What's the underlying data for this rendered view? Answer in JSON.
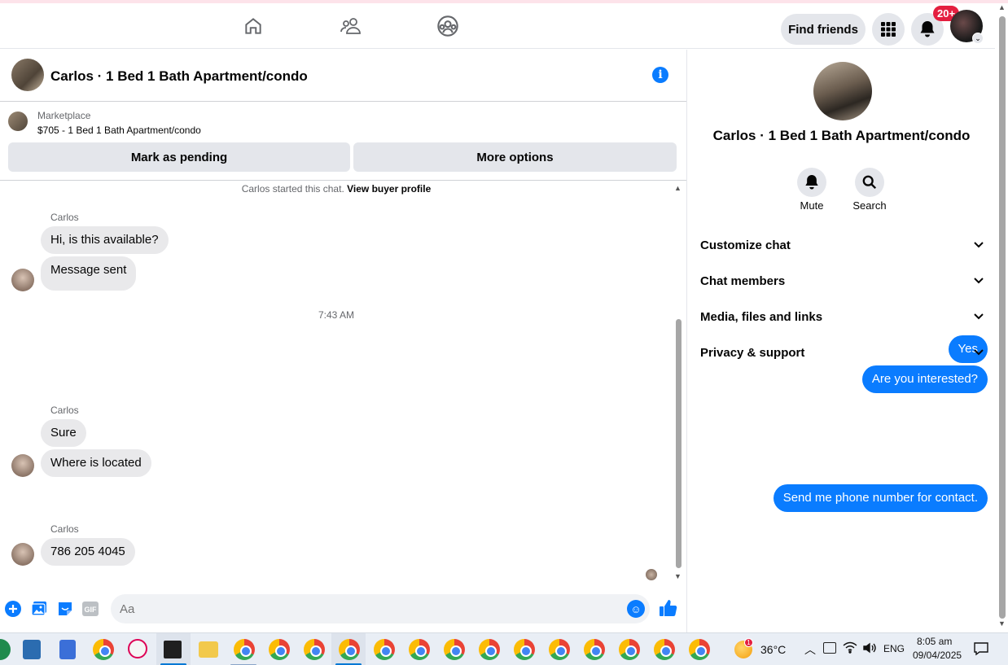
{
  "nav": {
    "find_friends": "Find friends",
    "notifications_badge": "20+"
  },
  "chat": {
    "title": "Carlos · 1 Bed 1 Bath Apartment/condo",
    "marketplace_label": "Marketplace",
    "listing": "$705 - 1 Bed 1 Bath Apartment/condo",
    "mark_pending": "Mark as pending",
    "more_options": "More options",
    "started_text": "Carlos started this chat.",
    "view_buyer_profile": "View buyer profile",
    "messages": [
      {
        "sender": "Carlos",
        "text": "Hi, is this available?"
      },
      {
        "text": "Message sent"
      },
      {
        "timestamp": "7:43 AM"
      },
      {
        "outgoing": true,
        "text": "Yes"
      },
      {
        "outgoing": true,
        "text": "Are you interested?"
      },
      {
        "sender": "Carlos",
        "text": "Sure"
      },
      {
        "text": "Where is located"
      },
      {
        "outgoing": true,
        "text": "Send me phone number for contact."
      },
      {
        "sender": "Carlos",
        "text": "786 205 4045"
      }
    ],
    "input_placeholder": "Aa"
  },
  "panel": {
    "title": "Carlos · 1 Bed 1 Bath Apartment/condo",
    "mute": "Mute",
    "search": "Search",
    "sections": [
      "Customize chat",
      "Chat members",
      "Media, files and links",
      "Privacy & support"
    ]
  },
  "taskbar": {
    "weather": "36°C",
    "weather_badge": "1",
    "lang": "ENG",
    "time": "8:05 am",
    "date": "09/04/2025"
  },
  "colors": {
    "accent": "#0a7cff",
    "incoming_bubble": "#e9e9eb",
    "button_gray": "#e4e6eb",
    "badge": "#e41e3f"
  }
}
